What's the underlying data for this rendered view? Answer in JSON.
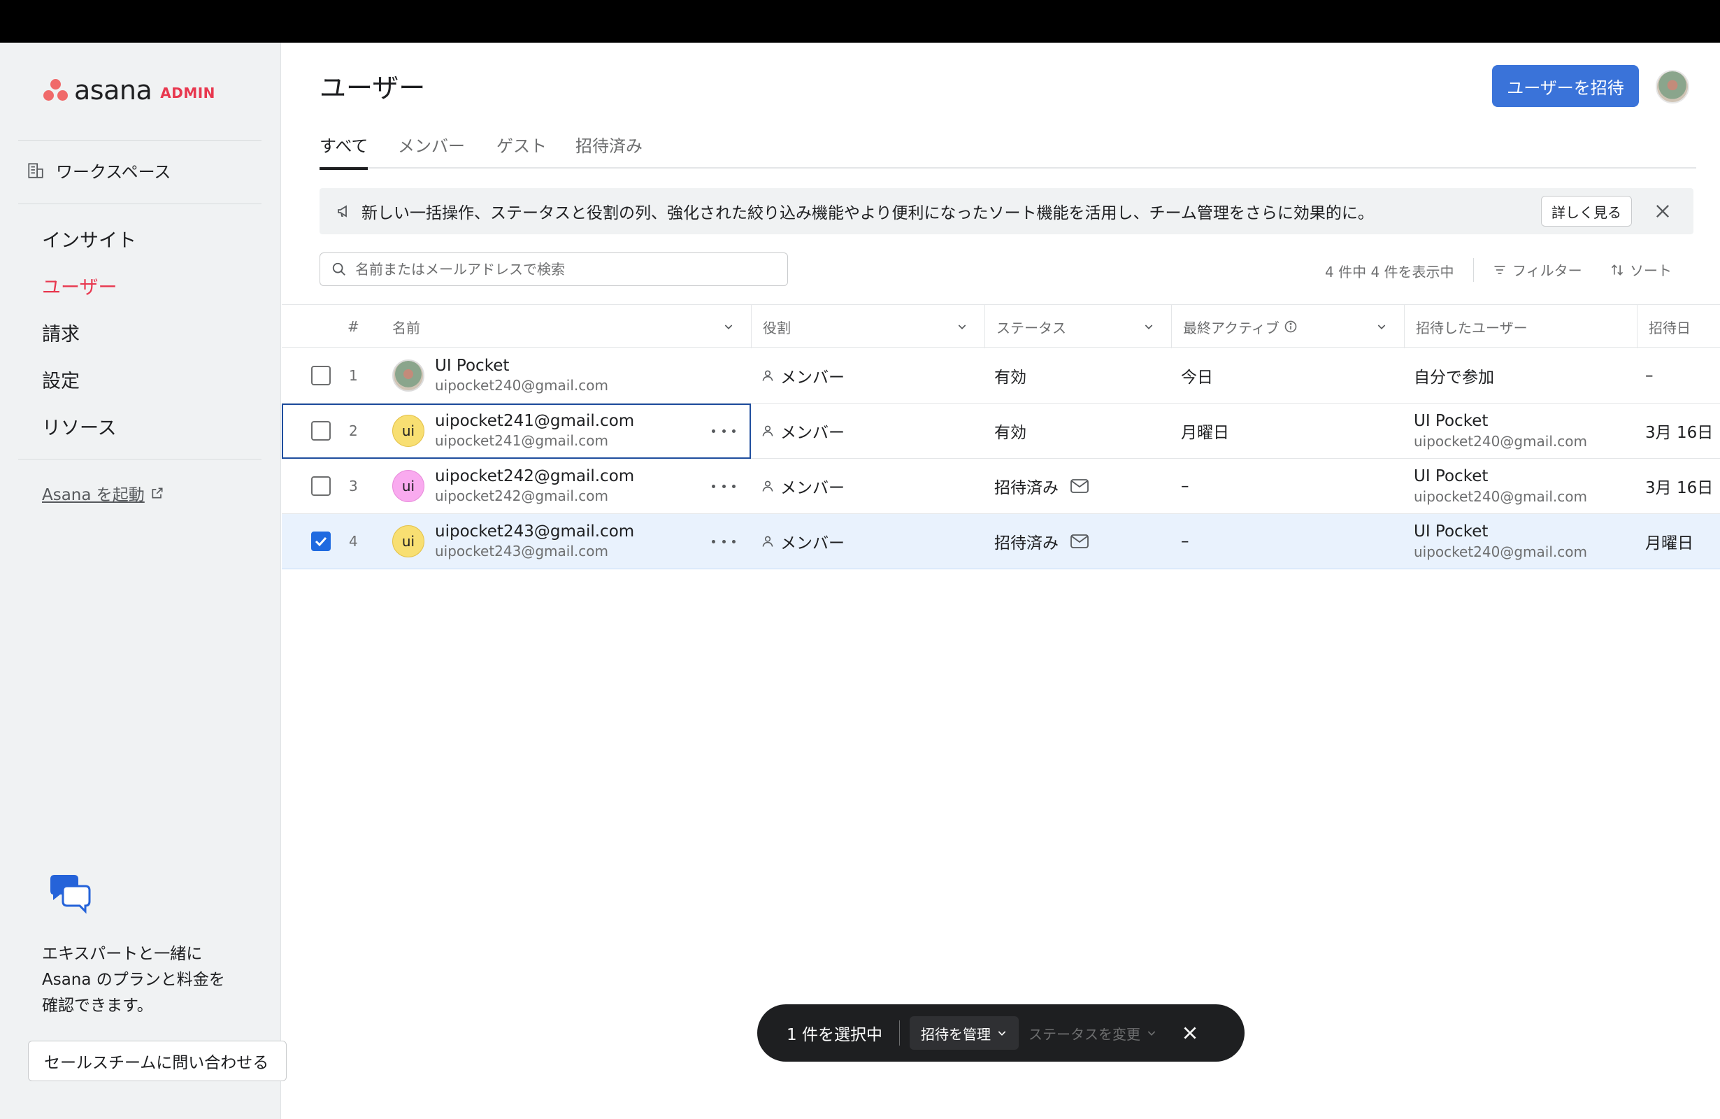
{
  "app": {
    "logo_text": "asana",
    "logo_badge": "ADMIN"
  },
  "sidebar": {
    "workspace_label": "ワークスペース",
    "nav": [
      {
        "label": "インサイト",
        "active": false
      },
      {
        "label": "ユーザー",
        "active": true
      },
      {
        "label": "請求",
        "active": false
      },
      {
        "label": "設定",
        "active": false
      },
      {
        "label": "リソース",
        "active": false
      }
    ],
    "launch_label": "Asana を起動",
    "promo_lines": [
      "エキスパートと一緒に",
      "Asana のプランと料金を",
      "確認できます。"
    ],
    "sales_button": "セールスチームに問い合わせる"
  },
  "header": {
    "title": "ユーザー",
    "invite_button": "ユーザーを招待"
  },
  "tabs": [
    {
      "label": "すべて",
      "active": true
    },
    {
      "label": "メンバー",
      "active": false
    },
    {
      "label": "ゲスト",
      "active": false
    },
    {
      "label": "招待済み",
      "active": false
    }
  ],
  "banner": {
    "text": "新しい一括操作、ステータスと役割の列、強化された絞り込み機能やより便利になったソート機能を活用し、チーム管理をさらに効果的に。",
    "more_button": "詳しく見る"
  },
  "toolbar": {
    "search_placeholder": "名前またはメールアドレスで検索",
    "count_text": "4 件中 4 件を表示中",
    "filter_label": "フィルター",
    "sort_label": "ソート"
  },
  "table": {
    "columns": {
      "num": "#",
      "name": "名前",
      "role": "役割",
      "status": "ステータス",
      "last_active": "最終アクティブ",
      "invited_by": "招待したユーザー",
      "invite_date": "招待日"
    },
    "rows": [
      {
        "num": "1",
        "avatar_text": "",
        "name": "UI Pocket",
        "email": "uipocket240@gmail.com",
        "role": "メンバー",
        "status": "有効",
        "last_active": "今日",
        "inviter_name": "自分で参加",
        "inviter_email": "",
        "invite_date": "–",
        "checked": false
      },
      {
        "num": "2",
        "avatar_text": "ui",
        "name": "uipocket241@gmail.com",
        "email": "uipocket241@gmail.com",
        "role": "メンバー",
        "status": "有効",
        "last_active": "月曜日",
        "inviter_name": "UI Pocket",
        "inviter_email": "uipocket240@gmail.com",
        "invite_date": "3月 16日",
        "checked": false
      },
      {
        "num": "3",
        "avatar_text": "ui",
        "name": "uipocket242@gmail.com",
        "email": "uipocket242@gmail.com",
        "role": "メンバー",
        "status": "招待済み",
        "last_active": "–",
        "inviter_name": "UI Pocket",
        "inviter_email": "uipocket240@gmail.com",
        "invite_date": "3月 16日",
        "checked": false
      },
      {
        "num": "4",
        "avatar_text": "ui",
        "name": "uipocket243@gmail.com",
        "email": "uipocket243@gmail.com",
        "role": "メンバー",
        "status": "招待済み",
        "last_active": "–",
        "inviter_name": "UI Pocket",
        "inviter_email": "uipocket240@gmail.com",
        "invite_date": "月曜日",
        "checked": true
      }
    ]
  },
  "bulk_bar": {
    "count_text": "1 件を選択中",
    "manage_label": "招待を管理",
    "status_label": "ステータスを変更"
  },
  "colors": {
    "accent": "#3a73d9",
    "active_nav": "#e8384f",
    "selected_row": "#e9f2fd"
  }
}
